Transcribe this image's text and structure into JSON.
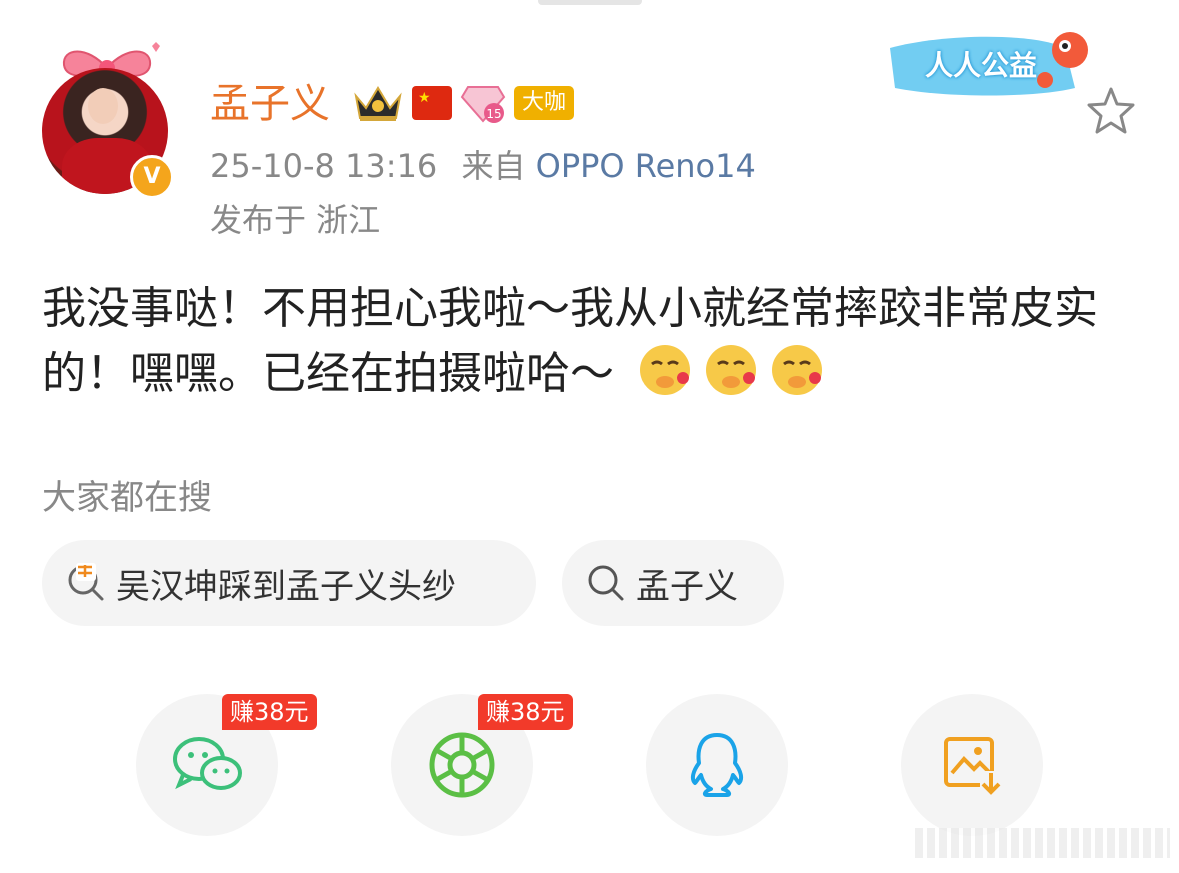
{
  "user": {
    "name": "孟子义",
    "badge_label": "大咖",
    "level": "15",
    "verified_mark": "V"
  },
  "post": {
    "time": "25-10-8 13:16",
    "source_prefix": "来自",
    "device": "OPPO Reno14",
    "location": "发布于 浙江",
    "text": "我没事哒！不用担心我啦～我从小就经常摔跤非常皮实的！嘿嘿。已经在拍摄啦哈～"
  },
  "charity": {
    "label": "人人公益"
  },
  "search": {
    "title": "大家都在搜",
    "items": [
      {
        "label": "吴汉坤踩到孟子义头纱",
        "icon": "hot-search-icon"
      },
      {
        "label": "孟子义",
        "icon": "search-icon"
      }
    ]
  },
  "share": {
    "earn_label": "赚38元",
    "items": [
      {
        "name": "wechat",
        "icon": "wechat-icon",
        "color": "#3cc07a"
      },
      {
        "name": "moments",
        "icon": "moments-icon",
        "color": "#5bbf45"
      },
      {
        "name": "qq",
        "icon": "qq-icon",
        "color": "#1aa3e8"
      },
      {
        "name": "save-image",
        "icon": "save-image-icon",
        "color": "#f0a020"
      }
    ]
  },
  "colors": {
    "name": "#e8732a",
    "device": "#5a7aa4",
    "earn": "#f23a2a"
  }
}
